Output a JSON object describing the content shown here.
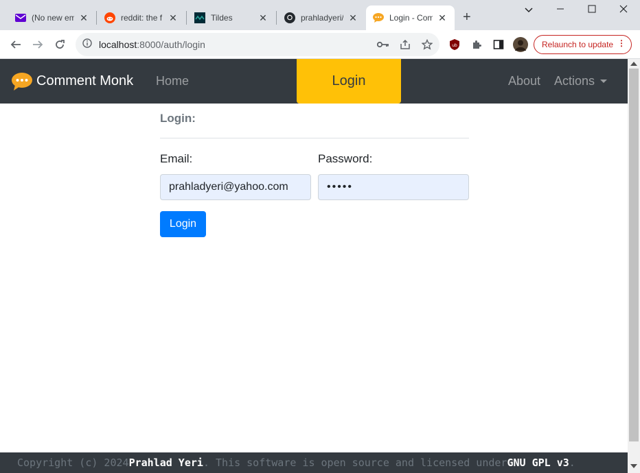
{
  "browser": {
    "tabs": [
      {
        "title": "(No new em",
        "icon": "mail-icon"
      },
      {
        "title": "reddit: the f",
        "icon": "reddit-icon"
      },
      {
        "title": "Tildes",
        "icon": "tildes-icon"
      },
      {
        "title": "prahladyeri/",
        "icon": "github-icon"
      },
      {
        "title": "Login - Com",
        "icon": "comment-icon",
        "active": true
      }
    ],
    "new_tab": "+",
    "url_host": "localhost",
    "url_path": ":8000/auth/login",
    "relaunch_label": "Relaunch to update",
    "relaunch_dots": "⋮"
  },
  "navbar": {
    "brand": "Comment Monk",
    "home": "Home",
    "login": "Login",
    "about": "About",
    "actions": "Actions"
  },
  "form": {
    "heading": "Login:",
    "email_label": "Email:",
    "password_label": "Password:",
    "email_value": "prahladyeri@yahoo.com",
    "password_value": "•••••",
    "submit": "Login"
  },
  "footer": {
    "prefix": "Copyright (c) 2024 ",
    "author": "Prahlad Yeri",
    "middle": ". This software is open source and licensed under ",
    "license": "GNU GPL v3",
    "suffix": "."
  },
  "colors": {
    "navbar_bg": "#343a40",
    "active_nav": "#ffc107",
    "primary": "#007bff",
    "autofill_bg": "#e8f0fe"
  }
}
